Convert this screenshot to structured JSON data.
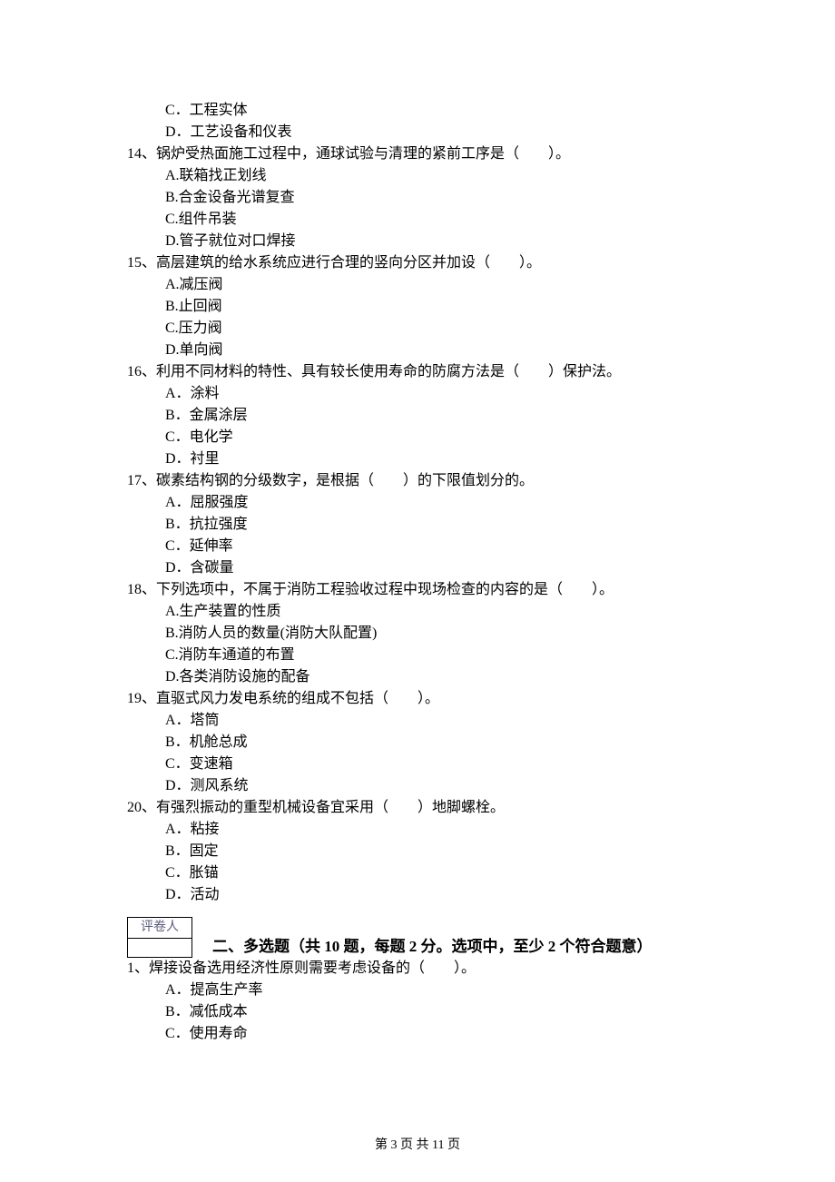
{
  "prev_options": {
    "c": "C．工程实体",
    "d": "D．工艺设备和仪表"
  },
  "q14": {
    "stem": "14、锅炉受热面施工过程中，通球试验与清理的紧前工序是（　　）。",
    "a": "A.联箱找正划线",
    "b": "B.合金设备光谱复查",
    "c": "C.组件吊装",
    "d": "D.管子就位对口焊接"
  },
  "q15": {
    "stem": "15、高层建筑的给水系统应进行合理的竖向分区并加设（　　）。",
    "a": "A.减压阀",
    "b": "B.止回阀",
    "c": "C.压力阀",
    "d": "D.单向阀"
  },
  "q16": {
    "stem": "16、利用不同材料的特性、具有较长使用寿命的防腐方法是（　　）保护法。",
    "a": "A．涂料",
    "b": "B．金属涂层",
    "c": "C．电化学",
    "d": "D．衬里"
  },
  "q17": {
    "stem": "17、碳素结构钢的分级数字，是根据（　　）的下限值划分的。",
    "a": "A．屈服强度",
    "b": "B．抗拉强度",
    "c": "C．延伸率",
    "d": "D．含碳量"
  },
  "q18": {
    "stem": "18、下列选项中，不属于消防工程验收过程中现场检查的内容的是（　　）。",
    "a": "A.生产装置的性质",
    "b": "B.消防人员的数量(消防大队配置)",
    "c": "C.消防车通道的布置",
    "d": "D.各类消防设施的配备"
  },
  "q19": {
    "stem": "19、直驱式风力发电系统的组成不包括（　　）。",
    "a": "A．塔筒",
    "b": "B．机舱总成",
    "c": "C．变速箱",
    "d": "D．测风系统"
  },
  "q20": {
    "stem": "20、有强烈振动的重型机械设备宜采用（　　）地脚螺栓。",
    "a": "A．粘接",
    "b": "B．固定",
    "c": "C．胀锚",
    "d": "D．活动"
  },
  "scorer_label": "评卷人",
  "section2": {
    "title": "二、多选题（共 10 题，每题 2 分。选项中，至少 2 个符合题意）"
  },
  "s2q1": {
    "stem": "1、焊接设备选用经济性原则需要考虑设备的（　　）。",
    "a": "A．提高生产率",
    "b": "B．减低成本",
    "c": "C．使用寿命"
  },
  "footer": "第 3 页 共 11 页"
}
